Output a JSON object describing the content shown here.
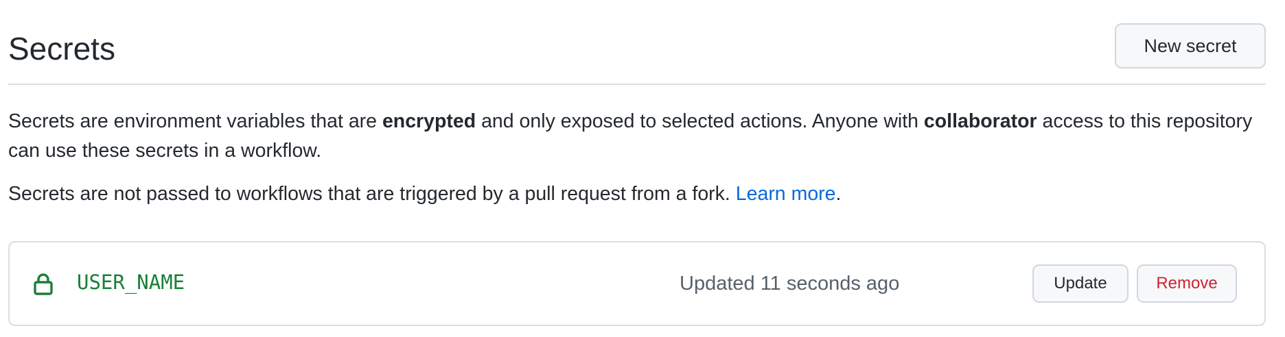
{
  "header": {
    "title": "Secrets",
    "new_secret_label": "New secret"
  },
  "description": {
    "p1_a": "Secrets are environment variables that are ",
    "p1_bold1": "encrypted",
    "p1_b": " and only exposed to selected actions. Anyone with ",
    "p1_bold2": "collaborator",
    "p1_c": " access to this repository can use these secrets in a workflow.",
    "p2_a": "Secrets are not passed to workflows that are triggered by a pull request from a fork. ",
    "p2_link": "Learn more",
    "p2_end": "."
  },
  "secrets": [
    {
      "icon": "lock-icon",
      "name": "USER_NAME",
      "updated": "Updated 11 seconds ago",
      "update_label": "Update",
      "remove_label": "Remove"
    }
  ],
  "colors": {
    "secret_name": "#1a7f37",
    "link": "#0969da",
    "remove": "#cf222e",
    "muted": "#57606a"
  }
}
